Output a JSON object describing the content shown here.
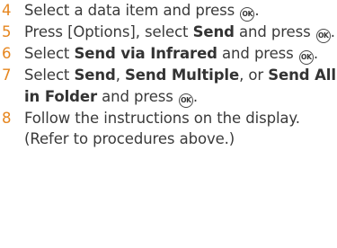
{
  "ok_key_label": "OK",
  "steps": [
    {
      "number": "4",
      "parts": [
        "Select a data item and press ",
        "."
      ]
    },
    {
      "number": "5",
      "parts": [
        "Press [Options], select ",
        "Send",
        " and press ",
        "."
      ]
    },
    {
      "number": "6",
      "parts": [
        "Select ",
        "Send via Infrared",
        " and press ",
        "."
      ]
    },
    {
      "number": "7",
      "parts": [
        "Select ",
        "Send",
        ", ",
        "Send Multiple",
        ", or ",
        "Send All in Folder",
        " and press ",
        "."
      ]
    },
    {
      "number": "8",
      "parts": [
        "Follow the instructions on the display. (Refer to procedures above.)"
      ]
    }
  ]
}
